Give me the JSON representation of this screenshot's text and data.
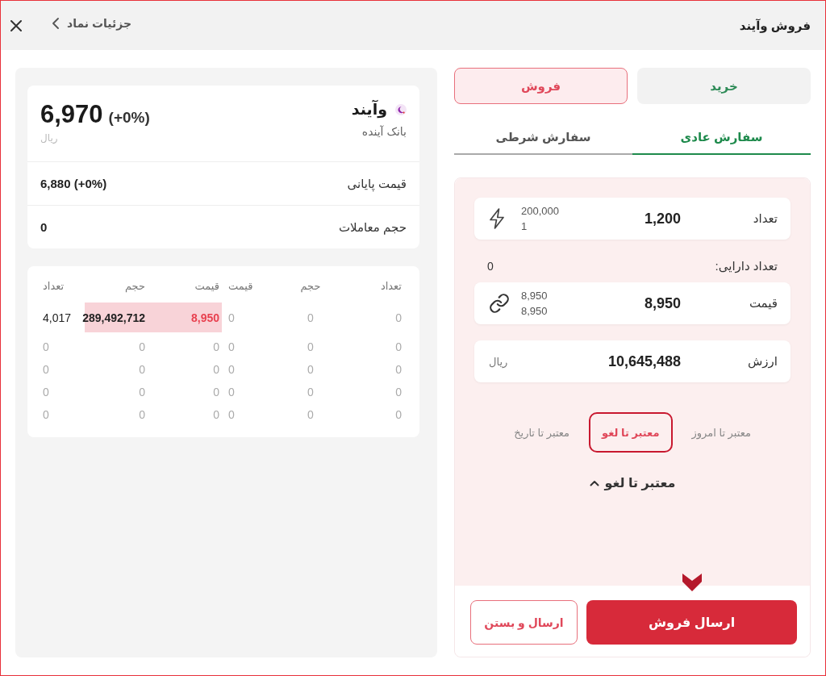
{
  "window": {
    "title": "فروش وآیند",
    "back_link": "جزئیات نماد"
  },
  "side_toggle": [
    {
      "label": "خرید",
      "kind": "buy",
      "selected": false
    },
    {
      "label": "فروش",
      "kind": "sell",
      "selected": true
    }
  ],
  "order_tabs": [
    {
      "label": "سفارش عادی",
      "selected": true
    },
    {
      "label": "سفارش شرطی",
      "selected": false
    }
  ],
  "order_form": {
    "quantity": {
      "label": "تعداد",
      "value": "1,200",
      "upper_limit": "200,000",
      "lower_limit": "1"
    },
    "holdings": {
      "label": "تعداد دارایی:",
      "value": "0"
    },
    "price": {
      "label": "قیمت",
      "value": "8,950",
      "upper_limit": "8,950",
      "lower_limit": "8,950"
    },
    "order_value": {
      "label": "ارزش",
      "value": "10,645,488",
      "currency": "ریال"
    },
    "validity_options": [
      {
        "label": "معتبر تا امروز",
        "selected": false
      },
      {
        "label": "معتبر تا لغو",
        "selected": true
      },
      {
        "label": "معتبر تا تاریخ",
        "selected": false
      }
    ],
    "validity_select": {
      "value": "معتبر تا لغو"
    }
  },
  "actions": [
    {
      "label": "ارسال فروش",
      "kind": "primary"
    },
    {
      "label": "ارسال و بستن",
      "kind": "secondary"
    }
  ],
  "symbol": {
    "name": "وآیند",
    "company": "بانک آینده",
    "price": "6,970",
    "change": "(+0%)",
    "currency": "ریال",
    "stats": [
      {
        "label": "قیمت پایانی",
        "value": "6,880 (+0%)"
      },
      {
        "label": "حجم معاملات",
        "value": "0"
      }
    ]
  },
  "order_book": {
    "buy_columns": [
      "تعداد",
      "حجم",
      "قیمت"
    ],
    "sell_columns": [
      "قیمت",
      "حجم",
      "تعداد"
    ],
    "rows": [
      {
        "buy": {
          "count": "0",
          "volume": "0",
          "price": "0",
          "highlighted": false
        },
        "sell": {
          "price": "8,950",
          "volume": "289,492,712",
          "count": "4,017",
          "highlighted": true
        }
      },
      {
        "buy": {
          "count": "0",
          "volume": "0",
          "price": "0",
          "highlighted": false
        },
        "sell": {
          "price": "0",
          "volume": "0",
          "count": "0",
          "highlighted": false
        }
      },
      {
        "buy": {
          "count": "0",
          "volume": "0",
          "price": "0",
          "highlighted": false
        },
        "sell": {
          "price": "0",
          "volume": "0",
          "count": "0",
          "highlighted": false
        }
      },
      {
        "buy": {
          "count": "0",
          "volume": "0",
          "price": "0",
          "highlighted": false
        },
        "sell": {
          "price": "0",
          "volume": "0",
          "count": "0",
          "highlighted": false
        }
      },
      {
        "buy": {
          "count": "0",
          "volume": "0",
          "price": "0",
          "highlighted": false
        },
        "sell": {
          "price": "0",
          "volume": "0",
          "count": "0",
          "highlighted": false
        }
      }
    ]
  }
}
